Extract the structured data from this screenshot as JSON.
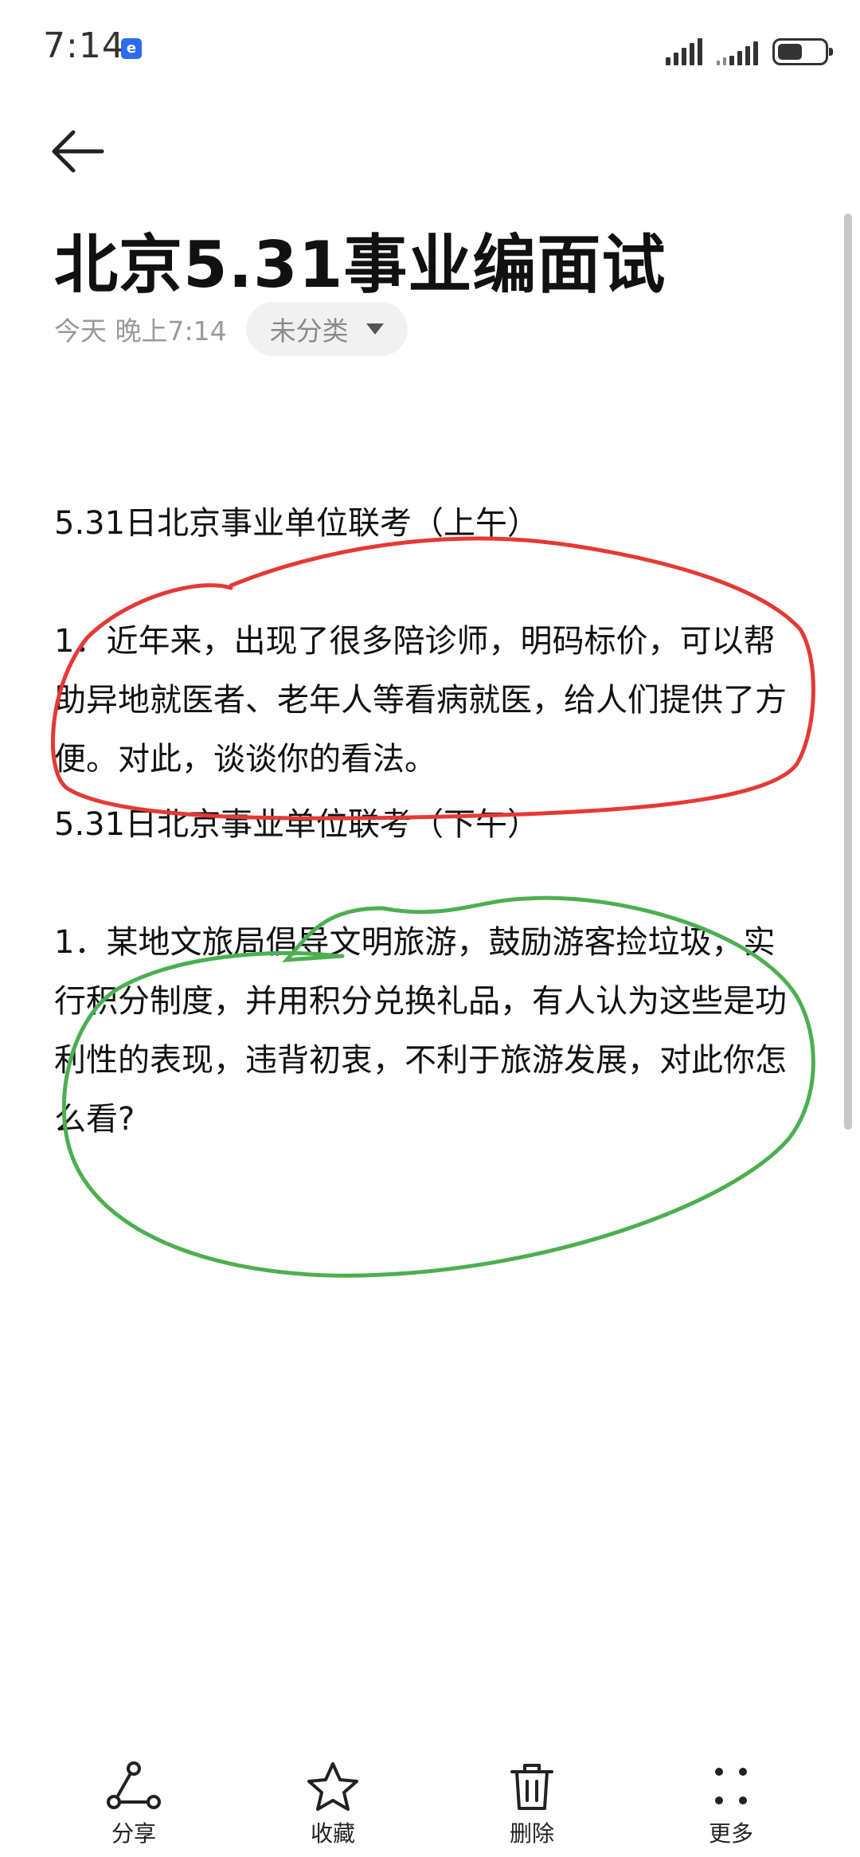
{
  "status_bar": {
    "time": "7:14"
  },
  "header": {
    "title": "北京5.31事业编面试",
    "date": "今天 晚上7:14",
    "category": "未分类"
  },
  "note": {
    "lines": [
      "5.31日北京事业单位联考（上午）",
      "",
      "1．近年来，出现了很多陪诊师，明码标价，可以帮助异地就医者、老年人等看病就医，给人们提供了方便。对此，谈谈你的看法。",
      "5.31日北京事业单位联考（下午）",
      "",
      "1．某地文旅局倡导文明旅游，鼓励游客捡垃圾，实行积分制度，并用积分兑换礼品，有人认为这些是功利性的表现，违背初衷，不利于旅游发展，对此你怎么看?"
    ]
  },
  "annotations": {
    "first_circle_color": "#e53935",
    "second_circle_color": "#4caf50"
  },
  "toolbar": {
    "share_label": "分享",
    "favorite_label": "收藏",
    "delete_label": "删除",
    "more_label": "更多"
  }
}
